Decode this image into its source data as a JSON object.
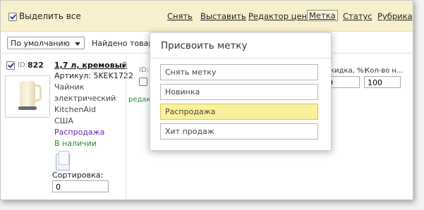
{
  "toolbar": {
    "select_all_label": "Выделить все",
    "actions": [
      {
        "label": "Снять"
      },
      {
        "label": "Выставить"
      },
      {
        "label": "Редактор цен"
      },
      {
        "label": "Метка"
      },
      {
        "label": "Статус"
      },
      {
        "label": "Рубрика"
      }
    ]
  },
  "filter": {
    "sort_select": "По умолчанию",
    "found_text": "Найдено товаро"
  },
  "product": {
    "id_label": "ID:",
    "id": "822",
    "name": "1,7 л, кремовый",
    "article": "Артикул: 5KEK1722",
    "desc1": "Чайник",
    "desc2": "электрический",
    "desc3": "KitchenAid",
    "country": "США",
    "tag": "Распродажа",
    "stock": "В наличии",
    "sort_label": "Сортировка:",
    "sort_value": "0"
  },
  "variant": {
    "id_label": "ID:",
    "edit_link": "редак",
    "discount_header": "кидка, %:",
    "discount_value": "0",
    "qty_header": "Кол-во н...",
    "qty_value": "100"
  },
  "popup": {
    "title": "Присвоить метку",
    "options": [
      {
        "label": "Снять метку"
      },
      {
        "label": "Новинка"
      },
      {
        "label": "Распродажа"
      },
      {
        "label": "Хит продаж"
      }
    ],
    "highlight_color": "#fbf19a"
  }
}
